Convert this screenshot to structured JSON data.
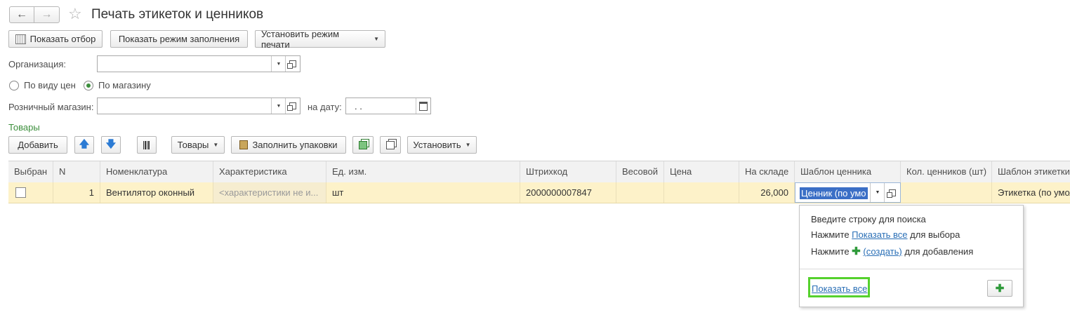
{
  "window": {
    "title": "Печать этикеток и ценников"
  },
  "toolbar": {
    "show_filter": "Показать отбор",
    "show_fill_mode": "Показать режим заполнения",
    "set_print_mode": "Установить режим печати"
  },
  "form": {
    "org_label": "Организация:",
    "org_value": "",
    "radio_price_kind": "По виду цен",
    "radio_store": "По магазину",
    "radio_selected": "store",
    "store_label": "Розничный магазин:",
    "store_value": "",
    "date_label": "на дату:",
    "date_value": ". ."
  },
  "goods": {
    "section_title": "Товары",
    "add_button": "Добавить",
    "goods_menu": "Товары",
    "fill_packages": "Заполнить упаковки",
    "set_menu": "Установить"
  },
  "table": {
    "columns": [
      "Выбран",
      "N",
      "Номенклатура",
      "Характеристика",
      "Ед. изм.",
      "Штрихкод",
      "Весовой",
      "Цена",
      "На складе",
      "Шаблон ценника",
      "Кол. ценников (шт)",
      "Шаблон этикетки"
    ],
    "row": {
      "selected": false,
      "n": "1",
      "name": "Вентилятор оконный",
      "characteristic": "<характеристики не и...",
      "unit": "шт",
      "barcode": "2000000007847",
      "weight": "",
      "price": "",
      "stock": "26,000",
      "price_tag_template": "Ценник (по умо",
      "price_tag_count": "",
      "label_template": "Этикетка (по умол"
    }
  },
  "popup": {
    "line1": "Введите строку для поиска",
    "line2_prefix": "Нажмите ",
    "line2_link": "Показать все",
    "line2_suffix": " для выбора",
    "line3_prefix": "Нажмите ",
    "line3_link": "(создать)",
    "line3_suffix": " для добавления",
    "show_all": "Показать все"
  },
  "colors": {
    "accent_green": "#3c8f3c",
    "highlight_green": "#55d12d",
    "row_yellow": "#fdf2c9",
    "selection_blue": "#3b6fc6"
  }
}
